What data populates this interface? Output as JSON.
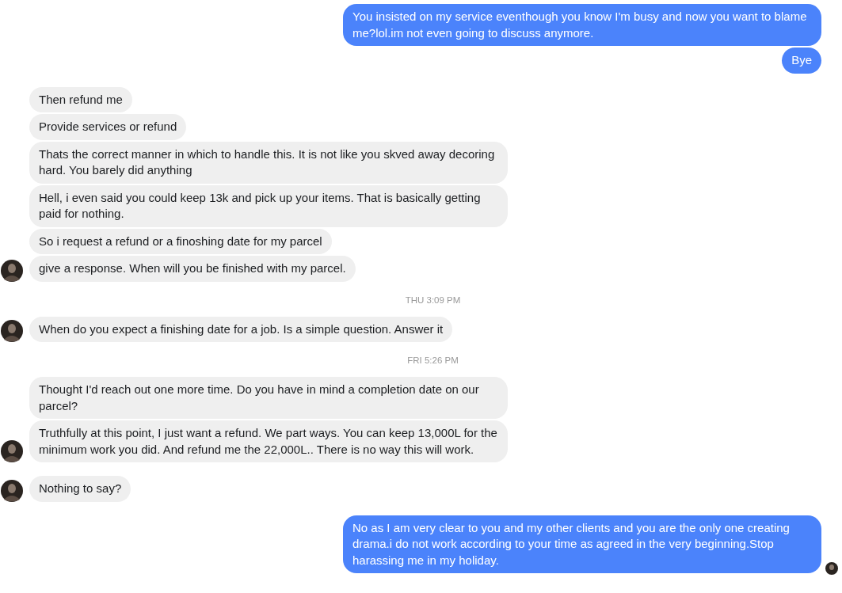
{
  "conversation": [
    {
      "kind": "sent",
      "messages": [
        {
          "text": "You insisted on my service eventhough you know I'm busy and now you want to blame me?lol.im not even going to discuss anymore.",
          "avatar": false
        },
        {
          "text": "Bye",
          "avatar": false
        }
      ]
    },
    {
      "kind": "received",
      "messages": [
        {
          "text": "Then refund me",
          "avatar": false
        },
        {
          "text": "Provide services or refund",
          "avatar": false
        },
        {
          "text": "Thats the correct manner in which to handle this. It is not like you skved away decoring hard. You barely did anything",
          "avatar": false
        },
        {
          "text": "Hell, i even said you could keep 13k and pick up your items. That is basically getting paid for nothing.",
          "avatar": false
        },
        {
          "text": "So i request a refund or a finoshing date for my parcel",
          "avatar": false
        },
        {
          "text": "give a response. When will you be finished with my parcel.",
          "avatar": true
        }
      ]
    },
    {
      "kind": "time",
      "text": "THU 3:09 PM"
    },
    {
      "kind": "received",
      "messages": [
        {
          "text": "When do you expect a finishing date for a job. Is a simple question. Answer it",
          "avatar": true
        }
      ]
    },
    {
      "kind": "time",
      "text": "FRI 5:26 PM"
    },
    {
      "kind": "received",
      "messages": [
        {
          "text": "Thought I'd reach out one more time. Do you have in mind a completion date on our parcel?",
          "avatar": false
        },
        {
          "text": "Truthfully at this point, I just want a refund. We part ways. You can keep 13,000L for the minimum work you did. And refund me the 22,000L.. There is no way this will work.",
          "avatar": true
        }
      ]
    },
    {
      "kind": "received",
      "messages": [
        {
          "text": "Nothing to say?",
          "avatar": true
        }
      ]
    },
    {
      "kind": "sent",
      "messages": [
        {
          "text": "No as I am very clear to you and my other clients and you are the only one creating drama.i do not work according to your time as agreed in the very beginning.Stop harassing me in my holiday.",
          "avatar": true
        }
      ]
    }
  ]
}
